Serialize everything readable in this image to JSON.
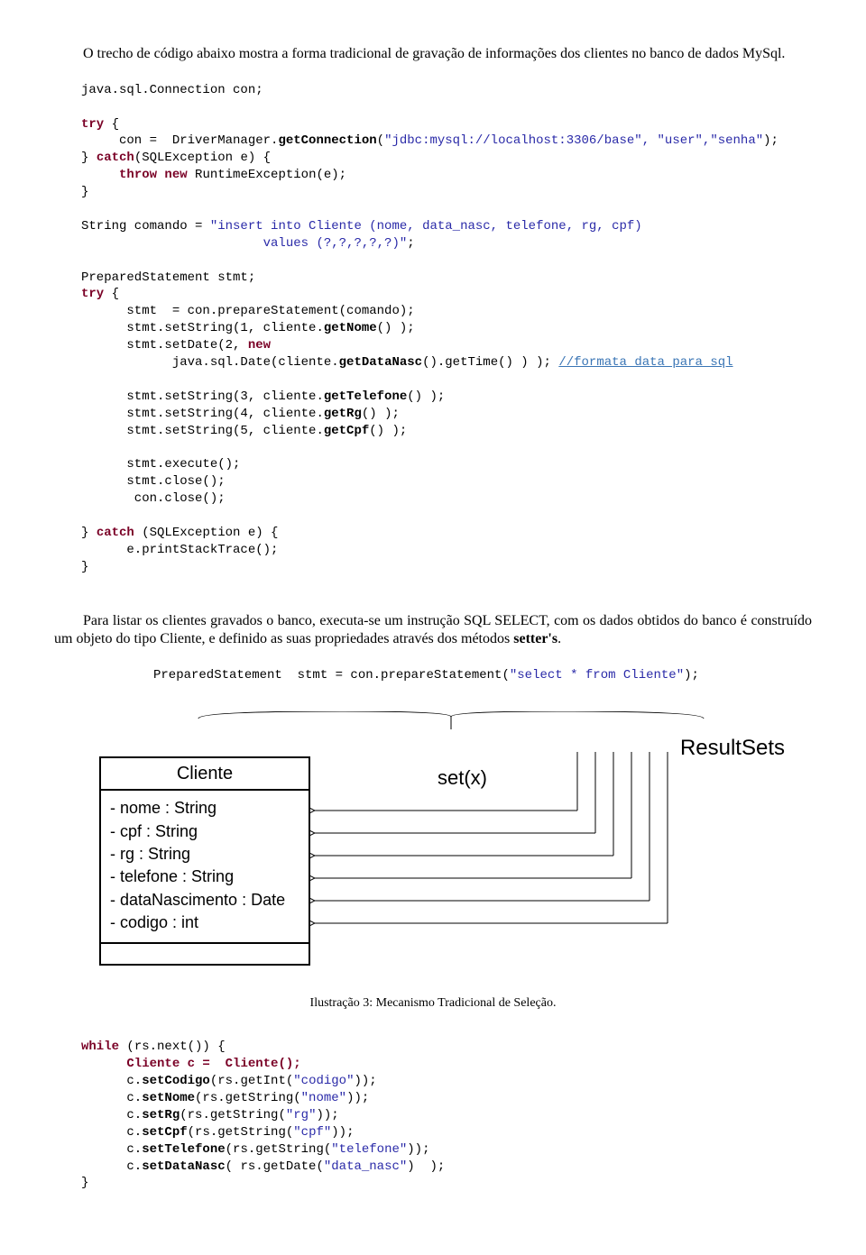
{
  "para1": "O trecho de código abaixo mostra a forma tradicional de gravação de informações dos clientes no banco de dados MySql.",
  "code1": {
    "l1": "java.sql.Connection con;",
    "try": "try",
    "l2": " {",
    "l3a": "     con =  DriverManager.",
    "l3b": "getConnection",
    "l3c": "(",
    "l3d": "\"jdbc:mysql://localhost:3306/base\", \"user\",\"senha\"",
    "l3e": ");",
    "l4a": "} ",
    "catch": "catch",
    "l4b": "(SQLException e) {",
    "throw": "throw new",
    "l5": " RuntimeException(e);",
    "l6": "}",
    "l7a": "String comando = ",
    "l7b": "\"insert into Cliente (nome, data_nasc, telefone, rg, cpf)",
    "l8": "                        values (?,?,?,?,?)\"",
    "l8b": ";",
    "l9": "PreparedStatement stmt;",
    "l10": " {",
    "l11": "      stmt  = con.prepareStatement(comando);",
    "l12a": "      stmt.setString(1, cliente.",
    "l12b": "getNome",
    "l12c": "() );",
    "l13a": "      stmt.setDate(2, ",
    "new": "new",
    "l14a": "            java.sql.Date(cliente.",
    "l14b": "getDataNasc",
    "l14c": "().getTime() ) ); ",
    "l14d": "//formata data para sql",
    "l15a": "      stmt.setString(3, cliente.",
    "l15b": "getTelefone",
    "l15c": "() );",
    "l16a": "      stmt.setString(4, cliente.",
    "l16b": "getRg",
    "l16c": "() );",
    "l17a": "      stmt.setString(5, cliente.",
    "l17b": "getCpf",
    "l17c": "() );",
    "l18": "      stmt.execute();",
    "l19": "      stmt.close();",
    "l20": "       con.close();",
    "l21a": "} ",
    "l21b": " (SQLException e) {",
    "l22": "      e.printStackTrace();",
    "l23": "}"
  },
  "para2": "Para listar os clientes gravados o banco, executa-se um instrução SQL SELECT, com os dados obtidos do banco é construído um objeto do tipo Cliente, e definido as suas propriedades através dos métodos ",
  "para2b": "setter's",
  "para2c": ".",
  "code2": {
    "l1a": "PreparedStatement  stmt = con.prepareStatement(",
    "l1b": "\"select * from Cliente\"",
    "l1c": ");"
  },
  "diagram": {
    "title": "Cliente",
    "attrs": [
      "- nome : String",
      "- cpf : String",
      "- rg : String",
      "- telefone : String",
      "- dataNascimento : Date",
      "- codigo : int"
    ],
    "setx": "set(x)",
    "resultsets": "ResultSets"
  },
  "caption": "Ilustração 3: Mecanismo Tradicional de Seleção.",
  "code3": {
    "while": "while",
    "l1": " (rs.next()) {",
    "l2a": "      Cliente c = ",
    "l2b": " Cliente();",
    "l3a": "      c.",
    "setCodigo": "setCodigo",
    "l3b": "(rs.getInt(",
    "q_codigo": "\"codigo\"",
    "l3c": "));",
    "setNome": "setNome",
    "l4b": "(rs.getString(",
    "q_nome": "\"nome\"",
    "l4c": "));",
    "setRg": "setRg",
    "q_rg": "\"rg\"",
    "setCpf": "setCpf",
    "q_cpf": "\"cpf\"",
    "setTelefone": "setTelefone",
    "q_telefone": "\"telefone\"",
    "setDataNasc": "setDataNasc",
    "l8b": "( rs.getDate(",
    "q_data": "\"data_nasc\"",
    "l8c": ")  );",
    "l9": "}"
  }
}
